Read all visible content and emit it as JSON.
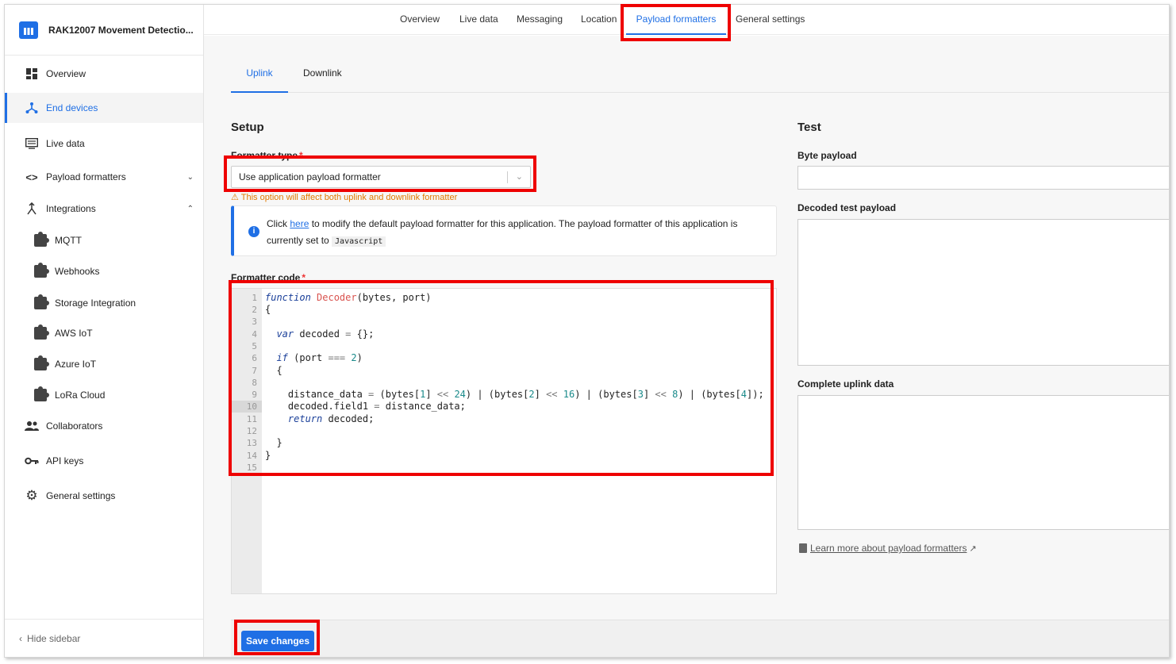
{
  "app": {
    "name": "RAK12007 Movement Detectio...",
    "hide_sidebar": "Hide sidebar"
  },
  "sidebar": {
    "items": [
      {
        "label": "Overview",
        "icon": "grid-icon"
      },
      {
        "label": "End devices",
        "icon": "devices-icon",
        "active": true
      },
      {
        "label": "Live data",
        "icon": "list-icon"
      },
      {
        "label": "Payload formatters",
        "icon": "code-icon"
      },
      {
        "label": "Integrations",
        "icon": "integration-icon"
      },
      {
        "label": "MQTT",
        "icon": "puzzle-icon"
      },
      {
        "label": "Webhooks",
        "icon": "puzzle-icon"
      },
      {
        "label": "Storage Integration",
        "icon": "puzzle-icon"
      },
      {
        "label": "AWS IoT",
        "icon": "puzzle-icon"
      },
      {
        "label": "Azure IoT",
        "icon": "puzzle-icon"
      },
      {
        "label": "LoRa Cloud",
        "icon": "puzzle-icon"
      },
      {
        "label": "Collaborators",
        "icon": "people-icon"
      },
      {
        "label": "API keys",
        "icon": "key-icon"
      },
      {
        "label": "General settings",
        "icon": "gear-icon"
      }
    ]
  },
  "top_tabs": [
    "Overview",
    "Live data",
    "Messaging",
    "Location",
    "Payload formatters",
    "General settings"
  ],
  "sub_tabs": [
    "Uplink",
    "Downlink"
  ],
  "setup": {
    "title": "Setup",
    "formatter_type_label": "Formatter type",
    "formatter_type_value": "Use application payload formatter",
    "warning": "This option will affect both uplink and downlink formatter",
    "info_pre": "Click ",
    "info_link": "here",
    "info_mid": " to modify the default payload formatter for this application. The payload formatter of this application is currently set to ",
    "info_code": "Javascript",
    "formatter_code_label": "Formatter code",
    "required_mark": "*"
  },
  "test": {
    "title": "Test",
    "byte_payload_label": "Byte payload",
    "decoded_label": "Decoded test payload",
    "complete_label": "Complete uplink data",
    "learn_more": "Learn more about payload formatters"
  },
  "footer": {
    "save_label": "Save changes"
  },
  "colors": {
    "accent": "#1f6fe5",
    "highlight": "#e00000",
    "warning": "#e07a00"
  }
}
